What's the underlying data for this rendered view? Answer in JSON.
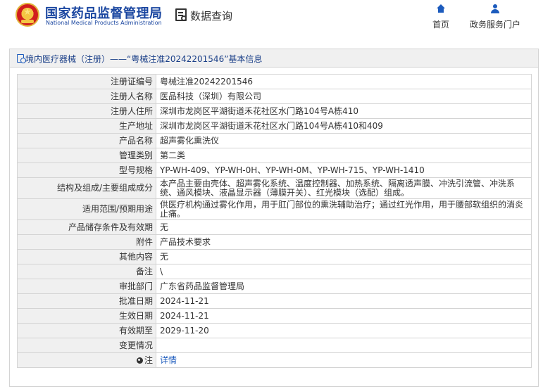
{
  "header": {
    "brand_cn": "国家药品监督管理局",
    "brand_en": "National Medical Products Administration",
    "query_label": "数据查询",
    "nav": [
      {
        "label": "首页",
        "icon": "home-icon"
      },
      {
        "label": "政务服务门户",
        "icon": "user-icon"
      }
    ]
  },
  "panel": {
    "title": "境内医疗器械（注册）——“粤械注准20242201546”基本信息",
    "rows": [
      {
        "label": "注册证编号",
        "value": "粤械注准20242201546"
      },
      {
        "label": "注册人名称",
        "value": "医品科技（深圳）有限公司"
      },
      {
        "label": "注册人住所",
        "value": "深圳市龙岗区平湖街道禾花社区水门路104号A栋410"
      },
      {
        "label": "生产地址",
        "value": "深圳市龙岗区平湖街道禾花社区水门路104号A栋410和409"
      },
      {
        "label": "产品名称",
        "value": "超声雾化熏洗仪"
      },
      {
        "label": "管理类别",
        "value": "第二类"
      },
      {
        "label": "型号规格",
        "value": "YP-WH-409、YP-WH-0H、YP-WH-0M、YP-WH-715、YP-WH-1410"
      },
      {
        "label": "结构及组成/主要组成成分",
        "value": "本产品主要由壳体、超声雾化系统、温度控制器、加热系统、隔离透声膜、冲洗引流管、冲洗系统、通风模块、液晶显示器（薄膜开关）、红光模块（选配）组成。"
      },
      {
        "label": "适用范围/预期用途",
        "value": "供医疗机构通过雾化作用，用于肛门部位的熏洗辅助治疗；通过红光作用，用于腰部软组织的消炎止痛。"
      },
      {
        "label": "产品储存条件及有效期",
        "value": "无"
      },
      {
        "label": "附件",
        "value": "产品技术要求"
      },
      {
        "label": "其他内容",
        "value": "无"
      },
      {
        "label": "备注",
        "value": "\\"
      },
      {
        "label": "审批部门",
        "value": "广东省药品监督管理局"
      },
      {
        "label": "批准日期",
        "value": "2024-11-21"
      },
      {
        "label": "生效日期",
        "value": "2024-11-21"
      },
      {
        "label": "有效期至",
        "value": "2029-11-20"
      },
      {
        "label": "变更情况",
        "value": ""
      },
      {
        "label": "注",
        "value": "详情",
        "icon": "info-icon"
      }
    ]
  },
  "colors": {
    "brand_blue": "#1a46a0",
    "link_blue": "#1c5bbd",
    "label_bg": "#f0f0f0",
    "border": "#d4d4d4"
  }
}
